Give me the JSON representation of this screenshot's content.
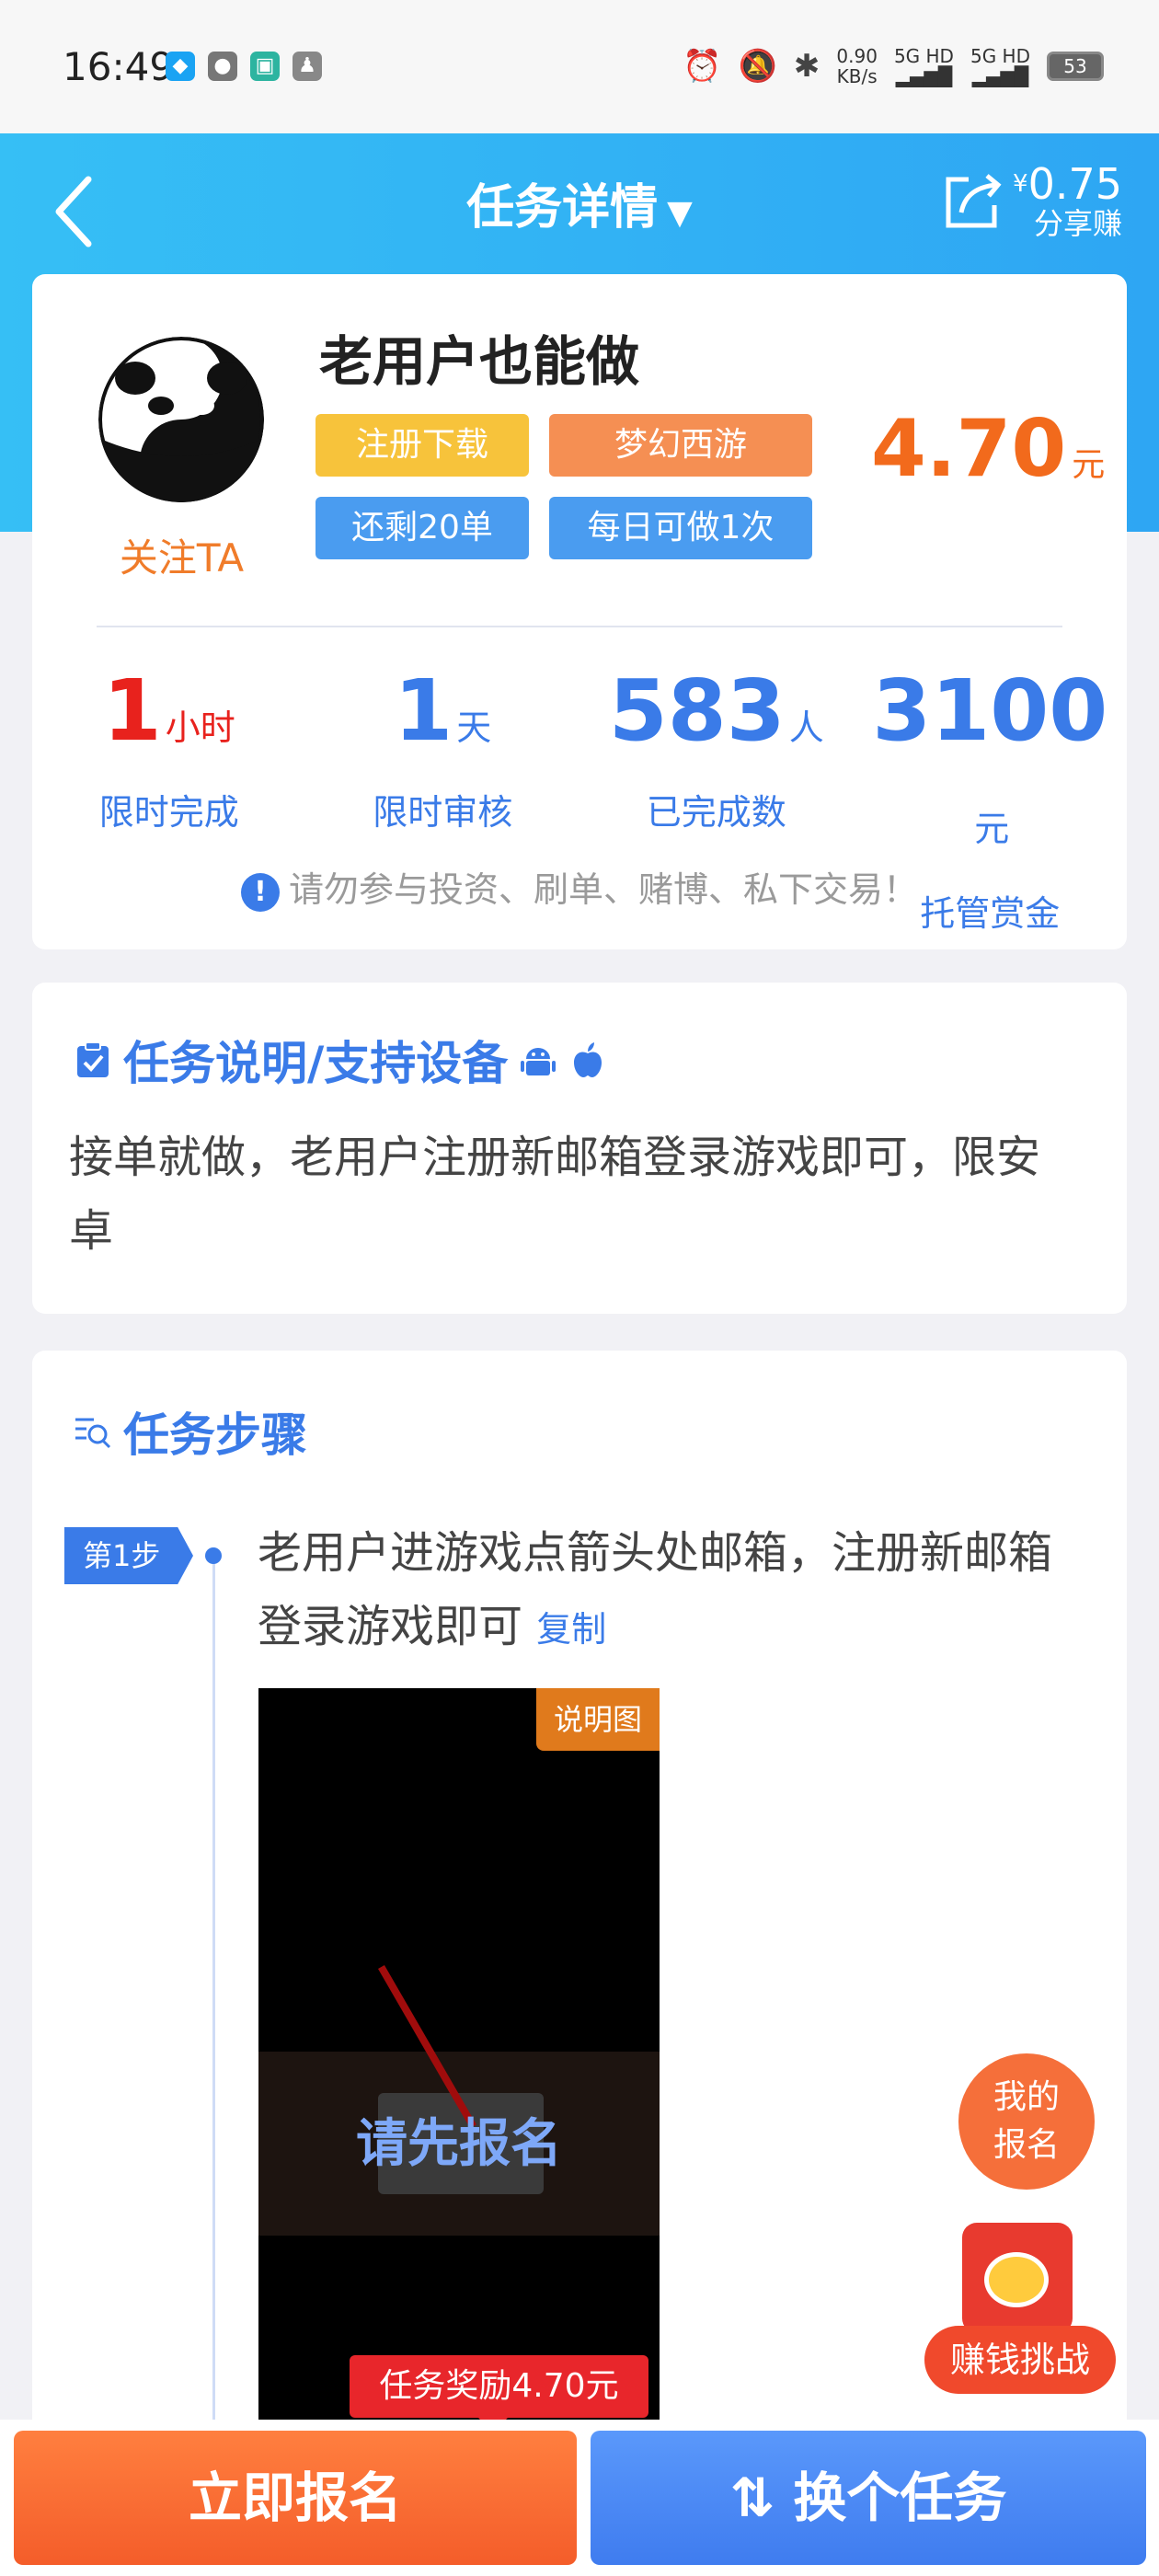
{
  "status_bar": {
    "time": "16:49",
    "net_speed_value": "0.90",
    "net_speed_unit": "KB/s",
    "sim1": "5G HD",
    "sim2": "5G HD",
    "battery": "53"
  },
  "header": {
    "title": "任务详情",
    "share_currency": "¥",
    "share_amount": "0.75",
    "share_label": "分享赚"
  },
  "task": {
    "follow_label": "关注TA",
    "title": "老用户也能做",
    "tags": [
      "注册下载",
      "梦幻西游",
      "还剩20单",
      "每日可做1次"
    ],
    "price": "4.70",
    "price_unit": "元",
    "stats": [
      {
        "value": "1",
        "unit": "小时",
        "label": "限时完成"
      },
      {
        "value": "1",
        "unit": "天",
        "label": "限时审核"
      },
      {
        "value": "583",
        "unit": "人",
        "label": "已完成数"
      },
      {
        "value": "3100",
        "unit": "元",
        "label": "托管赏金"
      }
    ],
    "warning_icon": "!",
    "warning": "请勿参与投资、刷单、赌博、私下交易！"
  },
  "description": {
    "title": "任务说明/支持设备",
    "text": "接单就做，老用户注册新邮箱登录游戏即可，限安卓"
  },
  "steps": {
    "title": "任务步骤",
    "items": [
      {
        "badge": "第1步",
        "text": "老用户进游戏点箭头处邮箱，注册新邮箱登录游戏即可",
        "copy_label": "复制",
        "image_tag": "说明图",
        "image_overlay": "请先报名"
      }
    ]
  },
  "floating": {
    "my_signup_line1": "我的",
    "my_signup_line2": "报名",
    "challenge": "赚钱挑战"
  },
  "bottom": {
    "reward_tip": "任务奖励4.70元",
    "signup_button": "立即报名",
    "switch_icon": "⇅",
    "switch_button": "换个任务"
  },
  "colors": {
    "header": "#2ea6f3",
    "accent_blue": "#3a7be8",
    "price_orange": "#f26a1c",
    "signup_orange": "#f45d2a"
  },
  "icons": [
    "back-icon",
    "dropdown-caret-icon",
    "share-icon",
    "clipboard-icon",
    "android-icon",
    "apple-icon",
    "search-list-icon",
    "red-packet-icon",
    "swap-icon"
  ]
}
